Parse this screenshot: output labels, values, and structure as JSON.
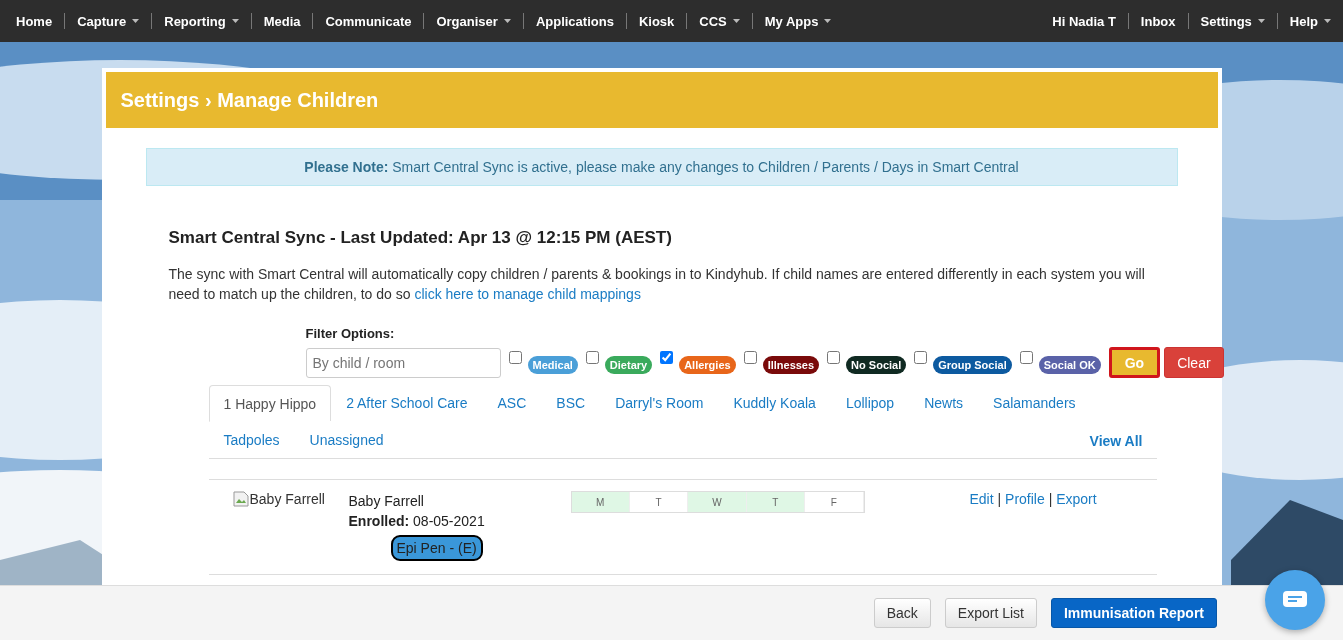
{
  "nav": {
    "left": [
      {
        "label": "Home",
        "dropdown": false
      },
      {
        "label": "Capture",
        "dropdown": true
      },
      {
        "label": "Reporting",
        "dropdown": true
      },
      {
        "label": "Media",
        "dropdown": false
      },
      {
        "label": "Communicate",
        "dropdown": false
      },
      {
        "label": "Organiser",
        "dropdown": true
      },
      {
        "label": "Applications",
        "dropdown": false
      },
      {
        "label": "Kiosk",
        "dropdown": false
      },
      {
        "label": "CCS",
        "dropdown": true
      },
      {
        "label": "My Apps",
        "dropdown": true
      }
    ],
    "right": [
      {
        "label": "Hi Nadia T",
        "dropdown": false
      },
      {
        "label": "Inbox",
        "dropdown": false
      },
      {
        "label": "Settings",
        "dropdown": true
      },
      {
        "label": "Help",
        "dropdown": true
      }
    ]
  },
  "page_title": "Settings › Manage Children",
  "note": {
    "label": "Please Note:",
    "text": "Smart Central Sync is active, please make any changes to Children / Parents / Days in Smart Central"
  },
  "sync": {
    "heading": "Smart Central Sync - Last Updated: Apr 13 @ 12:15 PM (AEST)",
    "text": "The sync with Smart Central will automatically copy children / parents & bookings in to Kindyhub. If child names are entered differently in each system you will need to match up the children, to do so",
    "link": "click here to manage child mappings"
  },
  "filter": {
    "label": "Filter Options:",
    "placeholder": "By child / room",
    "tags": [
      {
        "label": "Medical",
        "checked": false,
        "color": "#4a9fd8"
      },
      {
        "label": "Dietary",
        "checked": false,
        "color": "#3aaa5c"
      },
      {
        "label": "Allergies",
        "checked": true,
        "color": "#e8661a"
      },
      {
        "label": "Illnesses",
        "checked": false,
        "color": "#7a0a0a"
      },
      {
        "label": "No Social",
        "checked": false,
        "color": "#102a22"
      },
      {
        "label": "Group Social",
        "checked": false,
        "color": "#0d5aa0"
      },
      {
        "label": "Social OK",
        "checked": false,
        "color": "#5a62a8"
      }
    ],
    "go": "Go",
    "clear": "Clear"
  },
  "tabs": [
    {
      "label": "1 Happy Hippo",
      "selected": true
    },
    {
      "label": "2 After School Care",
      "selected": false
    },
    {
      "label": "ASC",
      "selected": false
    },
    {
      "label": "BSC",
      "selected": false
    },
    {
      "label": "Darryl's Room",
      "selected": false
    },
    {
      "label": "Kuddly Koala",
      "selected": false
    },
    {
      "label": "Lollipop",
      "selected": false
    },
    {
      "label": "Newts",
      "selected": false
    },
    {
      "label": "Salamanders",
      "selected": false
    },
    {
      "label": "Tadpoles",
      "selected": false
    },
    {
      "label": "Unassigned",
      "selected": false
    }
  ],
  "view_all": "View All",
  "children": [
    {
      "photo_alt": "Baby Farrell",
      "name": "Baby Farrell",
      "enrolled_label": "Enrolled:",
      "enrolled": "08-05-2021",
      "badges": [
        "Epi Pen - (E)"
      ],
      "days": [
        {
          "label": "M",
          "booked": true
        },
        {
          "label": "T",
          "booked": false
        },
        {
          "label": "W",
          "booked": true
        },
        {
          "label": "T",
          "booked": true
        },
        {
          "label": "F",
          "booked": false
        }
      ],
      "actions": [
        "Edit",
        "Profile",
        "Export"
      ],
      "action_separator": "|"
    }
  ],
  "footer": {
    "buttons": [
      {
        "label": "Back",
        "kind": "default"
      },
      {
        "label": "Export List",
        "kind": "default"
      },
      {
        "label": "Immunisation Report",
        "kind": "primary"
      }
    ]
  }
}
